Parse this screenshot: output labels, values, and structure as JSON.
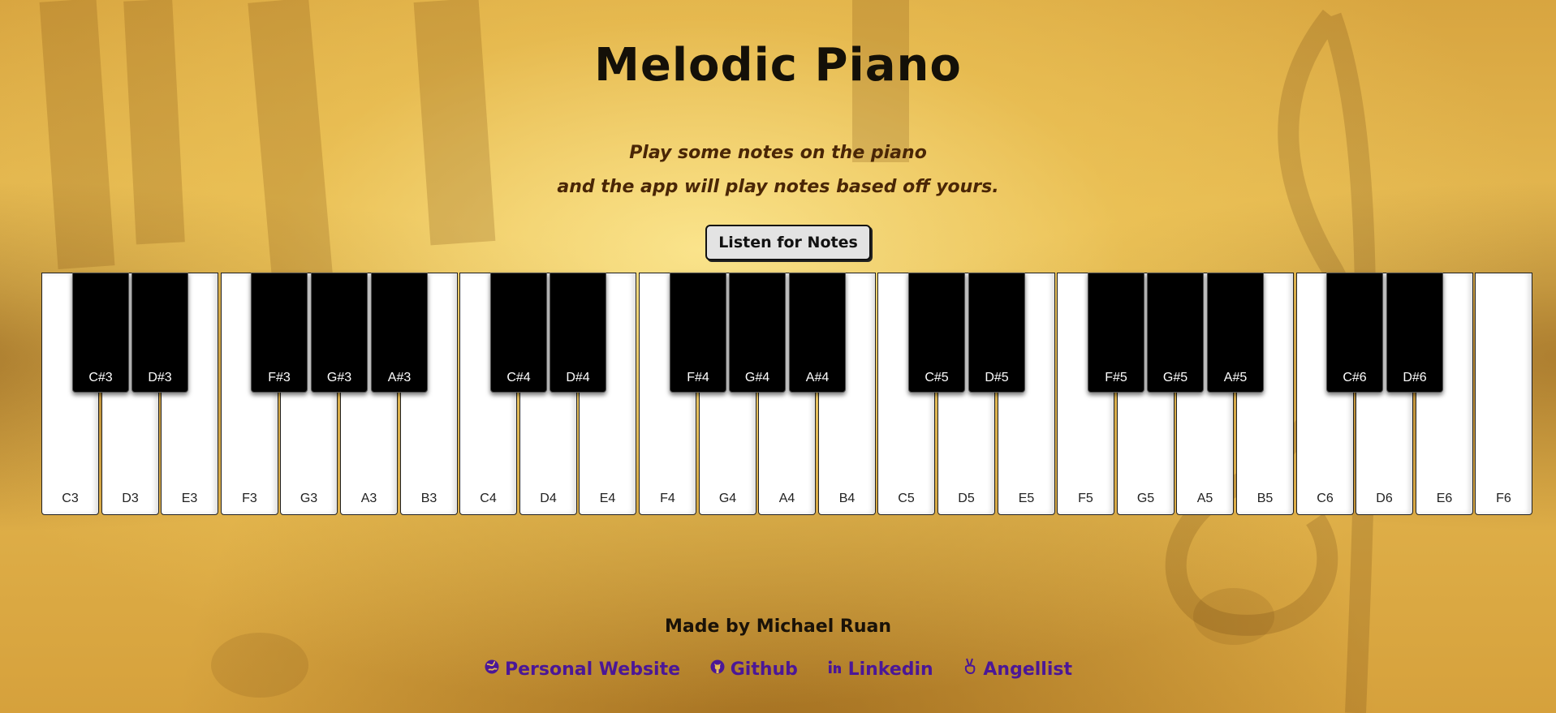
{
  "header": {
    "title": "Melodic Piano",
    "subtitle_line1": "Play some notes on the piano",
    "subtitle_line2": "and the app will play notes based off yours."
  },
  "controls": {
    "listen_button_label": "Listen for Notes"
  },
  "piano": {
    "white_keys": [
      "C3",
      "D3",
      "E3",
      "F3",
      "G3",
      "A3",
      "B3",
      "C4",
      "D4",
      "E4",
      "F4",
      "G4",
      "A4",
      "B4",
      "C5",
      "D5",
      "E5",
      "F5",
      "G5",
      "A5",
      "B5",
      "C6",
      "D6",
      "E6",
      "F6"
    ],
    "black_keys": [
      {
        "label": "C#3",
        "after_white": 0
      },
      {
        "label": "D#3",
        "after_white": 1
      },
      {
        "label": "F#3",
        "after_white": 3
      },
      {
        "label": "G#3",
        "after_white": 4
      },
      {
        "label": "A#3",
        "after_white": 5
      },
      {
        "label": "C#4",
        "after_white": 7
      },
      {
        "label": "D#4",
        "after_white": 8
      },
      {
        "label": "F#4",
        "after_white": 10
      },
      {
        "label": "G#4",
        "after_white": 11
      },
      {
        "label": "A#4",
        "after_white": 12
      },
      {
        "label": "C#5",
        "after_white": 14
      },
      {
        "label": "D#5",
        "after_white": 15
      },
      {
        "label": "F#5",
        "after_white": 17
      },
      {
        "label": "G#5",
        "after_white": 18
      },
      {
        "label": "A#5",
        "after_white": 19
      },
      {
        "label": "C#6",
        "after_white": 21
      },
      {
        "label": "D#6",
        "after_white": 22
      }
    ]
  },
  "footer": {
    "credit": "Made by Michael Ruan",
    "links": [
      {
        "label": "Personal Website",
        "icon": "globe-icon"
      },
      {
        "label": "Github",
        "icon": "github-icon"
      },
      {
        "label": "Linkedin",
        "icon": "linkedin-icon"
      },
      {
        "label": "Angellist",
        "icon": "angellist-icon"
      }
    ]
  },
  "colors": {
    "link": "#4b1797",
    "background": "#e0b04c"
  }
}
